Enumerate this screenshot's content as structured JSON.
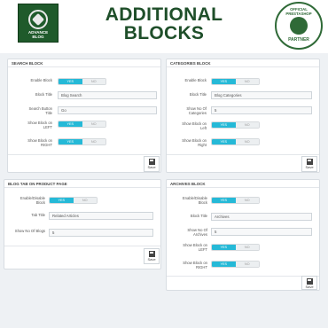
{
  "header": {
    "logo_text_1": "ADVANCE",
    "logo_text_2": "BLOG",
    "title_line1": "ADDITIONAL",
    "title_line2": "BLOCKS",
    "badge_top": "OFFICIAL PRESTASHOP",
    "badge_bottom": "PARTNER"
  },
  "toggle": {
    "yes": "YES",
    "no": "NO"
  },
  "save_label": "Save",
  "panels": {
    "search": {
      "title": "SEARCH BLOCK",
      "enable_label": "Enable Block",
      "block_title_label": "Block Title",
      "block_title_value": "Blog Search",
      "search_button_label": "Search Button Title",
      "search_button_value": "Go",
      "show_left_label": "Show Block on LEFT",
      "show_right_label": "Show Block on RIGHT"
    },
    "categories": {
      "title": "CATEGORIES BLOCK",
      "enable_label": "Enable Block",
      "block_title_label": "Block Title",
      "block_title_value": "Blog Categories",
      "show_no_label": "Show No Of Categories",
      "show_no_value": "5",
      "show_left_label": "Show Block on Left",
      "show_right_label": "Show Block on Right"
    },
    "blogtab": {
      "title": "BLOG TAB ON PRODUCT PAGE",
      "enable_label": "Enable/Disable Block",
      "tab_title_label": "Tab Title",
      "tab_title_value": "Related Articles",
      "show_no_label": "Show No Of Blogs",
      "show_no_value": "5"
    },
    "archives": {
      "title": "ARCHIVES BLOCK",
      "enable_label": "Enable/Disable Block",
      "block_title_label": "Block Title",
      "block_title_value": "Archives",
      "show_no_label": "Show No Of Archives",
      "show_no_value": "5",
      "show_left_label": "Show Block on LEFT",
      "show_right_label": "Show Block on RIGHT"
    }
  }
}
